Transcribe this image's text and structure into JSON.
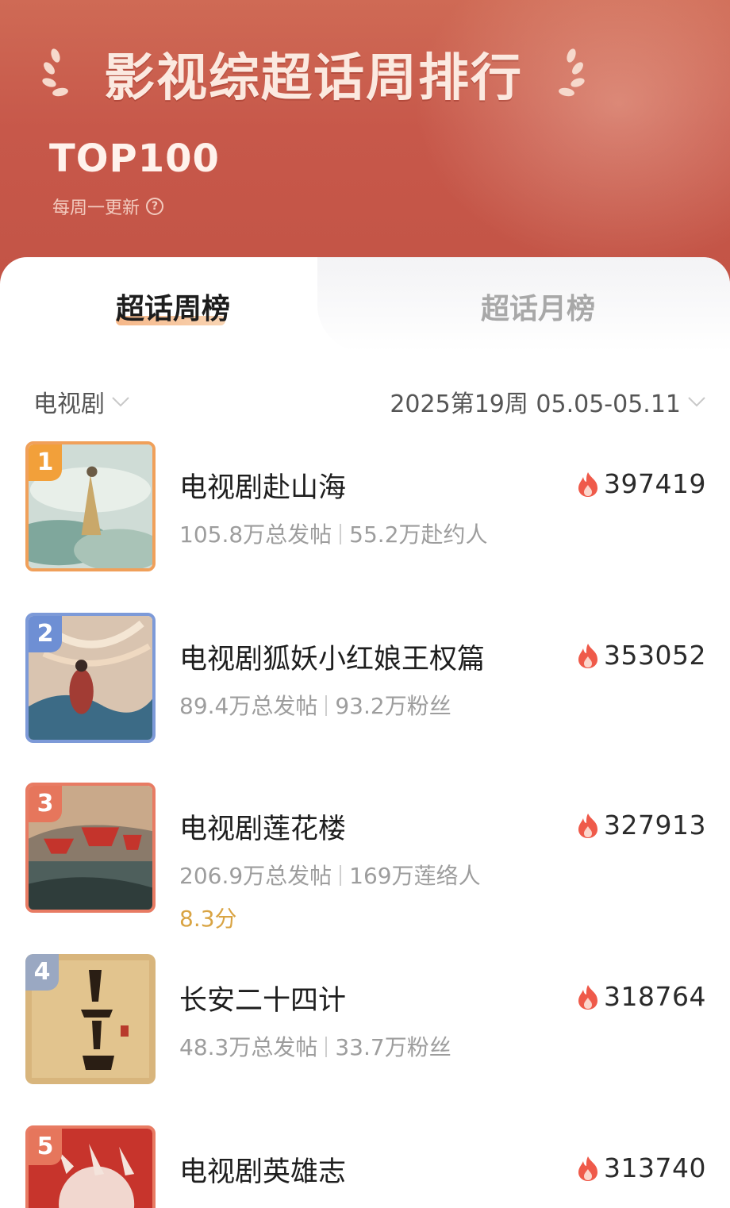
{
  "header": {
    "title": "影视综超话周排行",
    "subtitle": "TOP100",
    "update_note": "每周一更新",
    "help_icon": "question-circle-icon"
  },
  "tabs": [
    {
      "label": "超话周榜",
      "active": true
    },
    {
      "label": "超话月榜",
      "active": false
    }
  ],
  "filters": {
    "category": "电视剧",
    "week": "2025第19周 05.05-05.11"
  },
  "colors": {
    "header_bg": "#c7584a",
    "flame": "#ef5a4a",
    "rank_1": "#f2a03a",
    "rank_2": "#6e8fd4",
    "rank_3": "#e6765c",
    "rank_4": "#9aa8c2",
    "rank_5": "#e6765c",
    "score": "#d9a443"
  },
  "items": [
    {
      "rank": "1",
      "title": "电视剧赴山海",
      "stat1": "105.8万总发帖",
      "stat2": "55.2万赴约人",
      "score": "",
      "heat": "397419"
    },
    {
      "rank": "2",
      "title": "电视剧狐妖小红娘王权篇",
      "stat1": "89.4万总发帖",
      "stat2": "93.2万粉丝",
      "score": "",
      "heat": "353052"
    },
    {
      "rank": "3",
      "title": "电视剧莲花楼",
      "stat1": "206.9万总发帖",
      "stat2": "169万莲络人",
      "score": "8.3分",
      "heat": "327913"
    },
    {
      "rank": "4",
      "title": "长安二十四计",
      "stat1": "48.3万总发帖",
      "stat2": "33.7万粉丝",
      "score": "",
      "heat": "318764"
    },
    {
      "rank": "5",
      "title": "电视剧英雄志",
      "stat1": "",
      "stat2": "",
      "score": "",
      "heat": "313740"
    }
  ]
}
